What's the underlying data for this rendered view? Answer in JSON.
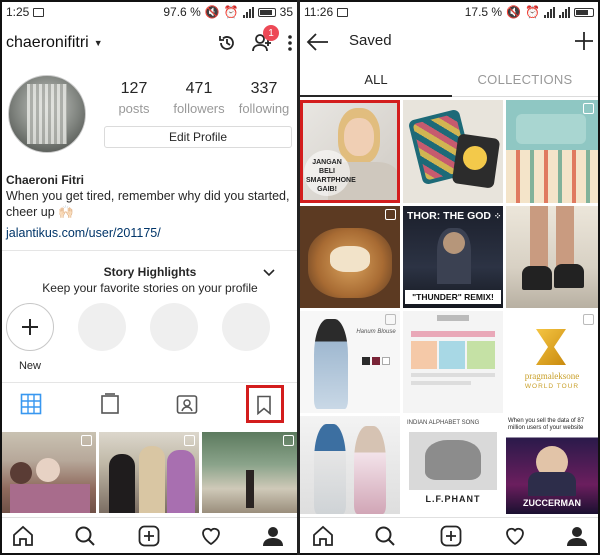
{
  "left": {
    "status": {
      "time": "1:25",
      "battery": "97.6 %",
      "battery_partial": "35"
    },
    "username": "chaeronifitri",
    "notification_count": "1",
    "stats": [
      {
        "num": "127",
        "label": "posts"
      },
      {
        "num": "471",
        "label": "followers"
      },
      {
        "num": "337",
        "label": "following"
      }
    ],
    "edit_profile": "Edit Profile",
    "bio": {
      "name": "Chaeroni Fitri",
      "text": "When you get tired, remember why did you started, cheer up 🙌🏻",
      "link": "jalantikus.com/user/201175/"
    },
    "highlights": {
      "title": "Story Highlights",
      "subtitle": "Keep your favorite stories on your profile",
      "new_label": "New"
    }
  },
  "right": {
    "status": {
      "time": "11:26",
      "battery": "17.5 %"
    },
    "title": "Saved",
    "tabs": {
      "all": "ALL",
      "collections": "COLLECTIONS"
    },
    "tiles": {
      "t1_text": "JANGAN BELI SMARTPHONE GAIB!",
      "t5_text": "THOR: THE GOD",
      "t5_sub": "\"THUNDER\" REMIX!",
      "t9_text": "pragmaleksone",
      "t9_sub": "WORLD TOUR",
      "t11_text": "INDIAN ALPHABET SONG",
      "t11_sub": "L.F.PHANT",
      "t12_text": "When you sell the data of 87 million users of your website",
      "t12_sub": "ZUCCERMAN"
    }
  },
  "colors": {
    "accent_red": "#d31d1d",
    "badge_red": "#ed4956",
    "link_blue": "#003569",
    "grid_blue": "#3897f0"
  },
  "icons": [
    "activity-icon",
    "add-user-icon",
    "more-icon",
    "grid-icon",
    "igtv-icon",
    "tagged-icon",
    "bookmark-icon",
    "home-icon",
    "search-icon",
    "new-post-icon",
    "heart-icon",
    "profile-icon",
    "back-arrow-icon",
    "plus-icon"
  ]
}
